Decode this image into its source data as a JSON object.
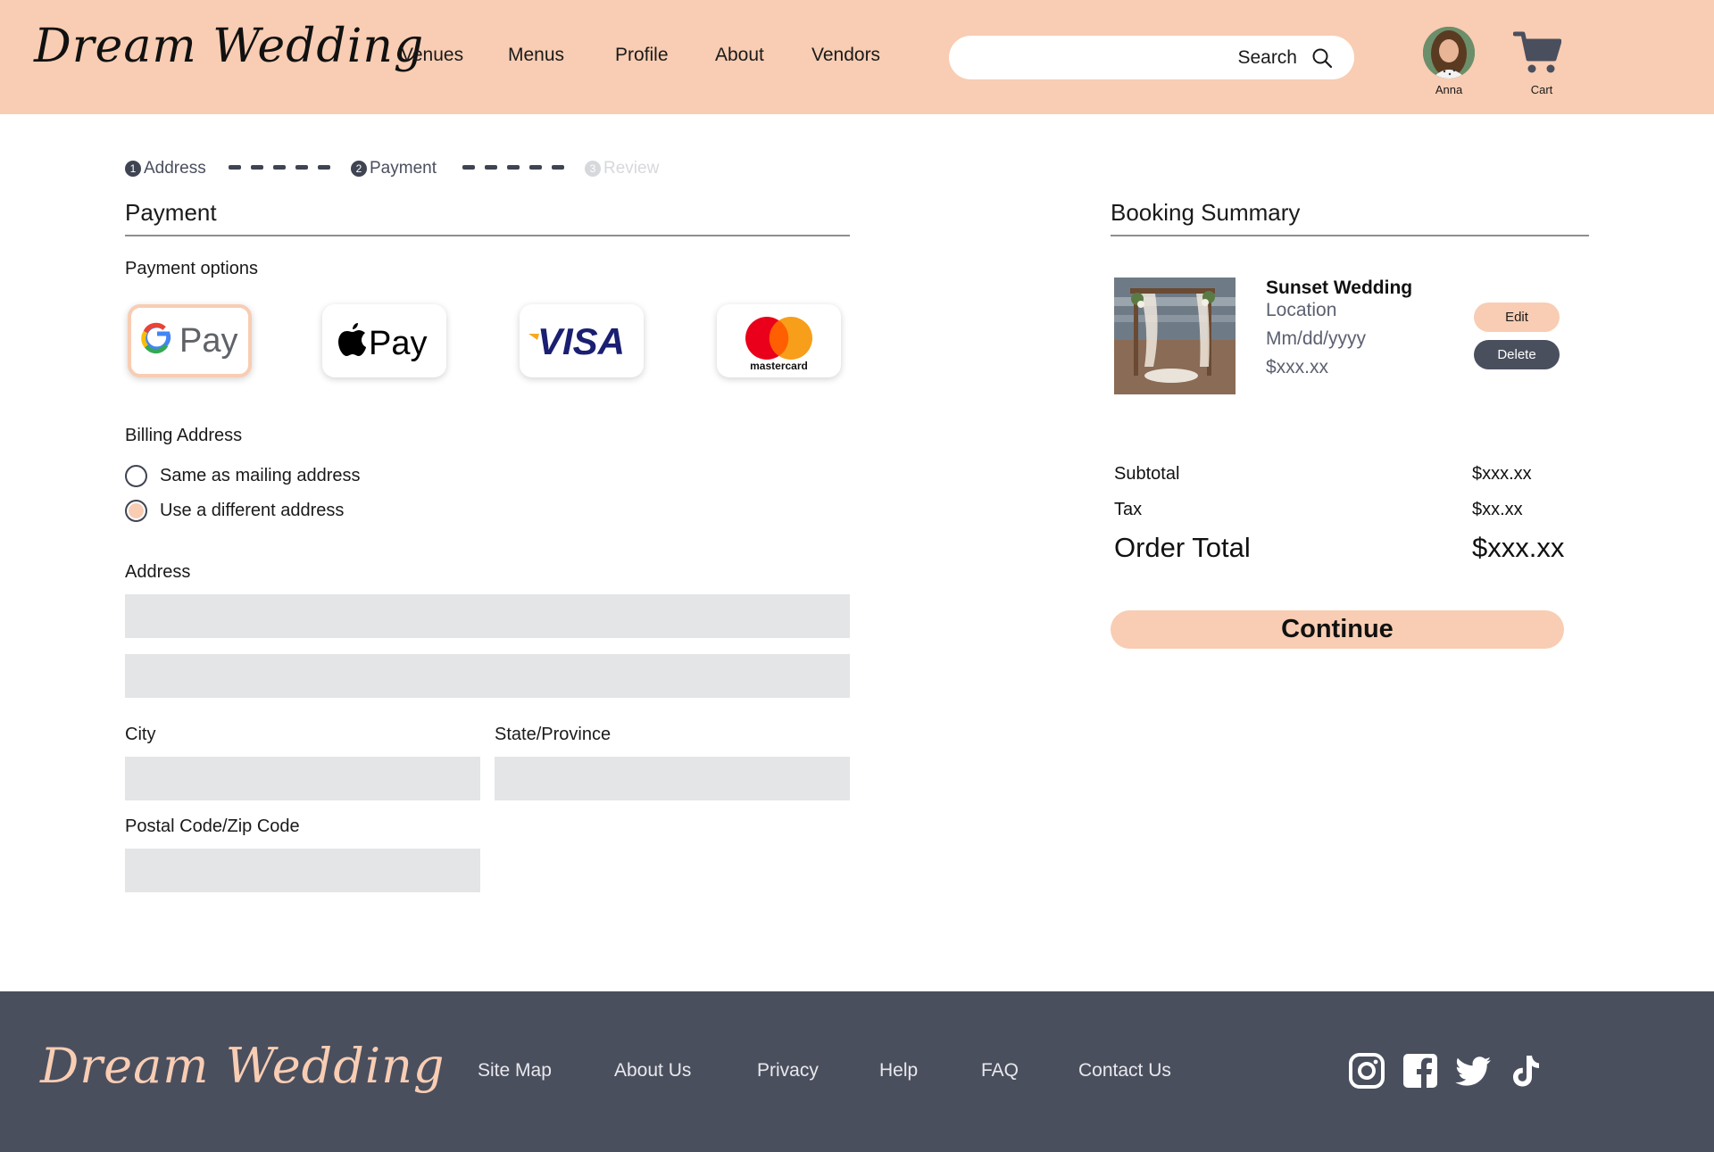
{
  "header": {
    "logo": "Dream Wedding",
    "nav": [
      "Venues",
      "Menus",
      "Profile",
      "About",
      "Vendors"
    ],
    "search_label": "Search",
    "user_name": "Anna",
    "cart_label": "Cart"
  },
  "stepper": {
    "steps": [
      {
        "num": "1",
        "label": "Address"
      },
      {
        "num": "2",
        "label": "Payment"
      },
      {
        "num": "3",
        "label": "Review"
      }
    ],
    "current_step": 2
  },
  "payment": {
    "title": "Payment",
    "options_label": "Payment options",
    "options": [
      "G Pay",
      "Apple Pay",
      "VISA",
      "mastercard"
    ],
    "selected_option": "G Pay",
    "billing_label": "Billing Address",
    "billing_choices": [
      "Same as mailing address",
      "Use a different address"
    ],
    "billing_selected": "Use a different address",
    "address_label": "Address",
    "city_label": "City",
    "state_label": "State/Province",
    "postal_label": "Postal Code/Zip Code"
  },
  "summary": {
    "title": "Booking Summary",
    "item": {
      "name": "Sunset Wedding",
      "location": "Location",
      "date": "Mm/dd/yyyy",
      "price": "$xxx.xx"
    },
    "edit_label": "Edit",
    "delete_label": "Delete",
    "subtotal_label": "Subtotal",
    "subtotal_value": "$xxx.xx",
    "tax_label": "Tax",
    "tax_value": "$xx.xx",
    "total_label": "Order Total",
    "total_value": "$xxx.xx",
    "continue_label": "Continue"
  },
  "footer": {
    "logo": "Dream Wedding",
    "links": [
      "Site Map",
      "About Us",
      "Privacy",
      "Help",
      "FAQ",
      "Contact Us"
    ],
    "social_icons": [
      "instagram-icon",
      "facebook-icon",
      "twitter-icon",
      "tiktok-icon"
    ]
  },
  "colors": {
    "peach": "#f8cdb3",
    "slate": "#4a4f5e",
    "field": "#e4e5e7"
  }
}
